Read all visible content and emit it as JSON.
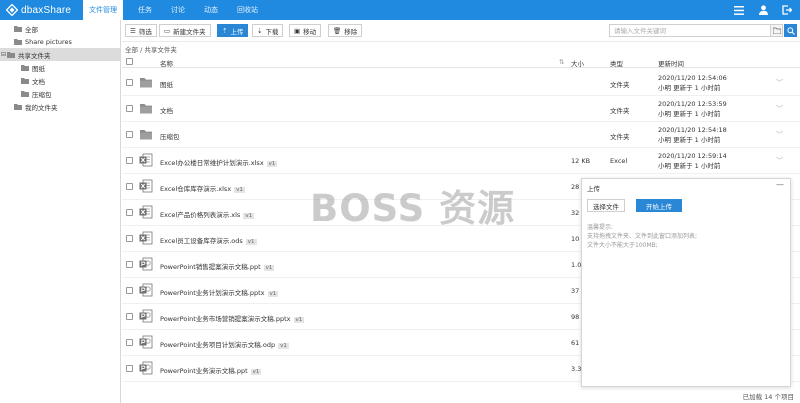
{
  "app": {
    "logo_text": "dbaxShare",
    "brand_color": "#1f8ae0"
  },
  "nav": {
    "tabs": [
      "文件管理",
      "任务",
      "讨论",
      "动态",
      "回收站"
    ],
    "active_index": 0
  },
  "sidebar": {
    "items": [
      {
        "label": "全部",
        "level": 0
      },
      {
        "label": "Share pictures",
        "level": 0
      },
      {
        "label": "共享文件夹",
        "level": 0,
        "expanded": true,
        "selected": true
      },
      {
        "label": "图纸",
        "level": 1
      },
      {
        "label": "文档",
        "level": 1
      },
      {
        "label": "压缩包",
        "level": 1
      },
      {
        "label": "我的文件夹",
        "level": 0
      }
    ]
  },
  "toolbar": {
    "filter": "筛选",
    "new_folder": "新建文件夹",
    "upload": "上传",
    "download": "下载",
    "move": "移动",
    "remove": "移除",
    "search_placeholder": "请输入文件关键词"
  },
  "breadcrumb": "全部 / 共享文件夹",
  "table": {
    "headers": {
      "name": "名称",
      "size": "大小",
      "type": "类型",
      "time": "更新时间"
    },
    "rows": [
      {
        "name": "图纸",
        "version": "",
        "size": "",
        "type": "文件夹",
        "time": "2020/11/20 12:54:06",
        "user": "小明 更新于 1 小时前",
        "icon": "folder-icon"
      },
      {
        "name": "文档",
        "version": "",
        "size": "",
        "type": "文件夹",
        "time": "2020/11/20 12:53:59",
        "user": "小明 更新于 1 小时前",
        "icon": "folder-icon"
      },
      {
        "name": "压缩包",
        "version": "",
        "size": "",
        "type": "文件夹",
        "time": "2020/11/20 12:54:18",
        "user": "小明 更新于 1 小时前",
        "icon": "folder-icon"
      },
      {
        "name": "Excel办公楼日常维护计划演示.xlsx",
        "version": "v1",
        "size": "12 KB",
        "type": "Excel",
        "time": "2020/11/20 12:59:14",
        "user": "小明 更新于 1 小时前",
        "icon": "excel-file-icon"
      },
      {
        "name": "Excel仓库库存演示.xlsx",
        "version": "v1",
        "size": "28",
        "type": "",
        "time": "",
        "user": "",
        "icon": "excel-file-icon"
      },
      {
        "name": "Excel产品价格列表演示.xls",
        "version": "v1",
        "size": "32",
        "type": "",
        "time": "",
        "user": "",
        "icon": "excel-file-icon"
      },
      {
        "name": "Excel员工设备库存演示.ods",
        "version": "v1",
        "size": "10",
        "type": "",
        "time": "",
        "user": "",
        "icon": "excel-file-icon"
      },
      {
        "name": "PowerPoint销售提案演示文稿.ppt",
        "version": "v1",
        "size": "1.0",
        "type": "",
        "time": "",
        "user": "",
        "icon": "ppt-file-icon"
      },
      {
        "name": "PowerPoint业务计划演示文稿.pptx",
        "version": "v1",
        "size": "37",
        "type": "",
        "time": "",
        "user": "",
        "icon": "ppt-file-icon"
      },
      {
        "name": "PowerPoint业务市场营销提案演示文稿.pptx",
        "version": "v1",
        "size": "98",
        "type": "",
        "time": "",
        "user": "",
        "icon": "ppt-file-icon"
      },
      {
        "name": "PowerPoint业务项目计划演示文稿.odp",
        "version": "v1",
        "size": "61",
        "type": "",
        "time": "",
        "user": "",
        "icon": "ppt-file-icon"
      },
      {
        "name": "PowerPoint业务演示文稿.ppt",
        "version": "v1",
        "size": "3.3",
        "type": "",
        "time": "",
        "user": "",
        "icon": "ppt-file-icon"
      }
    ]
  },
  "status": "已加载 14 个项目",
  "upload_panel": {
    "title": "上传",
    "minimize": "—",
    "choose": "选择文件",
    "start": "开始上传",
    "hint_title": "温馨提示:",
    "hint_1": "支持拖拽文件夹、文件到此窗口添加列表;",
    "hint_2": "文件大小不能大于100MB;"
  },
  "watermark": "BOSS 资源"
}
